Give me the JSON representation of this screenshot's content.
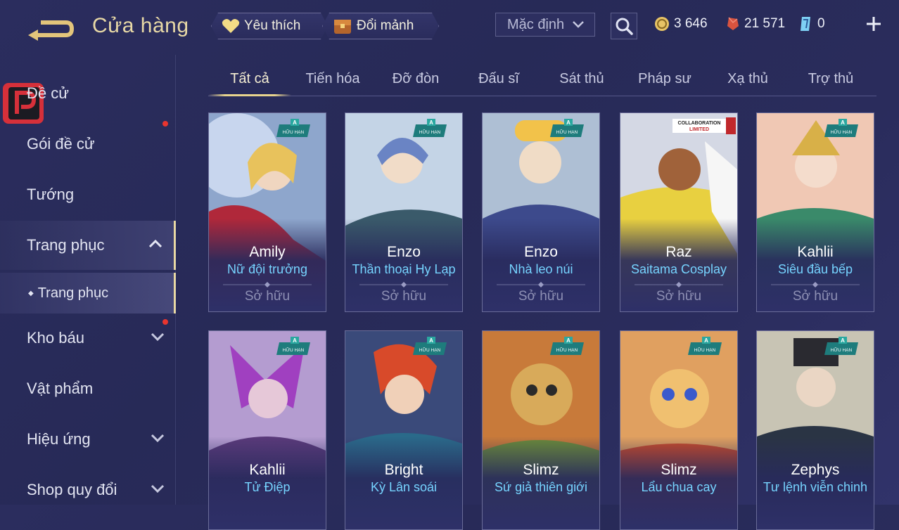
{
  "header": {
    "title": "Cửa hàng",
    "favorite_label": "Yêu thích",
    "fragment_label": "Đổi mảnh",
    "sort_value": "Mặc định",
    "currencies": {
      "gold": "3 646",
      "voucher": "21 571",
      "diamond": "0"
    }
  },
  "sidebar": {
    "items": [
      {
        "label": "Đề cử"
      },
      {
        "label": "Gói đề cử"
      },
      {
        "label": "Tướng"
      },
      {
        "label": "Trang phục"
      },
      {
        "label": "Trang phục"
      },
      {
        "label": "Kho báu"
      },
      {
        "label": "Vật phẩm"
      },
      {
        "label": "Hiệu ứng"
      },
      {
        "label": "Shop quy đổi"
      }
    ]
  },
  "tabs": [
    "Tất cả",
    "Tiến hóa",
    "Đỡ đòn",
    "Đấu sĩ",
    "Sát thủ",
    "Pháp sư",
    "Xạ thủ",
    "Trợ thủ"
  ],
  "badge": {
    "rank": "A",
    "limited": "HỮU HẠN",
    "collab_1": "COLLABORATION",
    "collab_2": "LIMITED"
  },
  "cards": [
    {
      "hero": "Amily",
      "skin": "Nữ đội trưởng",
      "status": "Sở hữu"
    },
    {
      "hero": "Enzo",
      "skin": "Thần thoại Hy Lạp",
      "status": "Sở hữu"
    },
    {
      "hero": "Enzo",
      "skin": "Nhà leo núi",
      "status": "Sở hữu"
    },
    {
      "hero": "Raz",
      "skin": "Saitama Cosplay",
      "status": "Sở hữu"
    },
    {
      "hero": "Kahlii",
      "skin": "Siêu đầu bếp",
      "status": "Sở hữu"
    },
    {
      "hero": "Kahlii",
      "skin": "Tử Điệp"
    },
    {
      "hero": "Bright",
      "skin": "Kỳ Lân soái"
    },
    {
      "hero": "Slimz",
      "skin": "Sứ giả thiên giới"
    },
    {
      "hero": "Slimz",
      "skin": "Lẩu chua cay"
    },
    {
      "hero": "Zephys",
      "skin": "Tư lệnh viễn chinh"
    }
  ],
  "colors": {
    "accent_gold": "#e8d48e",
    "skin_name": "#76d4ff",
    "notify_dot": "#e8352f"
  }
}
